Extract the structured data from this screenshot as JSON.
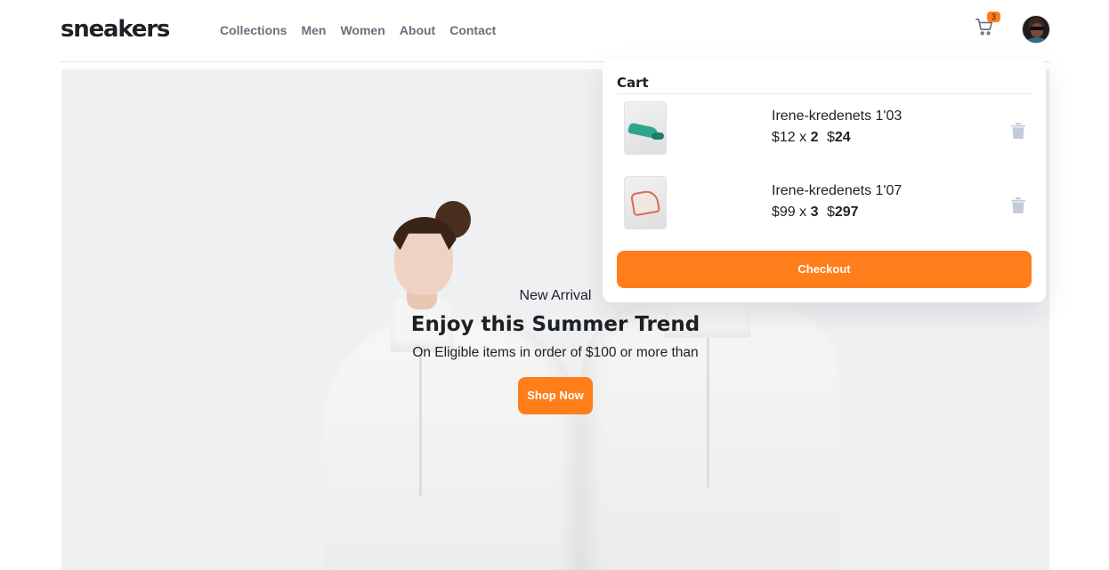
{
  "brand": {
    "logo": "sneakers"
  },
  "nav": {
    "items": [
      {
        "label": "Collections"
      },
      {
        "label": "Men"
      },
      {
        "label": "Women"
      },
      {
        "label": "About"
      },
      {
        "label": "Contact"
      }
    ]
  },
  "header": {
    "cart_icon": "cart-icon",
    "cart_count": "3",
    "avatar_icon": "avatar"
  },
  "hero": {
    "subtitle": "New Arrival",
    "title": "Enjoy this Summer Trend",
    "description": "On Eligible items in order of $100 or more than",
    "cta_label": "Shop Now"
  },
  "cart": {
    "title": "Cart",
    "items": [
      {
        "name": "Irene-kredenets 1'03",
        "unit_price": "$12 x",
        "quantity": "2",
        "total_prefix": "$",
        "total": "24"
      },
      {
        "name": "Irene-kredenets 1'07",
        "unit_price": "$99 x",
        "quantity": "3",
        "total_prefix": "$",
        "total": "297"
      }
    ],
    "delete_icon": "trash-icon",
    "checkout_label": "Checkout"
  },
  "colors": {
    "accent": "#ff7e1b",
    "text_dark": "#1d2026",
    "text_muted": "#69707d",
    "hero_bg": "#eef0f2"
  }
}
